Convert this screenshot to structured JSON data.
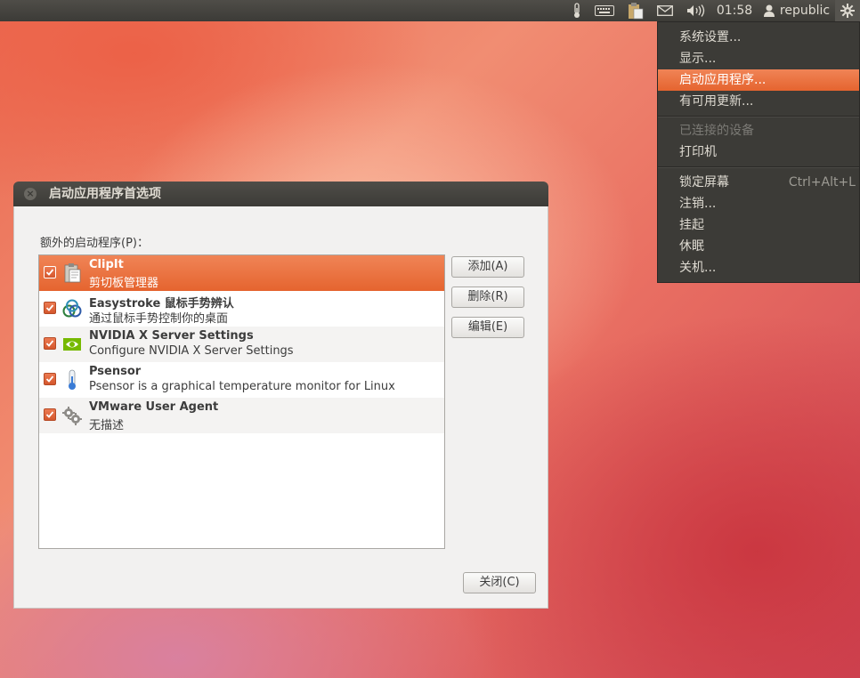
{
  "panel": {
    "clock": "01:58",
    "user": "republic",
    "icons": [
      "thermometer-icon",
      "keyboard-icon",
      "clipboard-icon",
      "mail-icon",
      "volume-icon",
      "user-icon",
      "gear-icon"
    ]
  },
  "system_menu": {
    "items": [
      {
        "label": "系统设置..."
      },
      {
        "label": "显示..."
      },
      {
        "label": "启动应用程序...",
        "state": "highlighted"
      },
      {
        "label": "有可用更新..."
      },
      {
        "label": "已连接的设备",
        "state": "disabled"
      },
      {
        "label": "打印机"
      },
      {
        "label": "锁定屏幕",
        "accel": "Ctrl+Alt+L"
      },
      {
        "label": "注销..."
      },
      {
        "label": "挂起"
      },
      {
        "label": "休眠"
      },
      {
        "label": "关机..."
      }
    ]
  },
  "dialog": {
    "title": "启动应用程序首选项",
    "list_label": "额外的启动程序(P)：",
    "apps": [
      {
        "name": "ClipIt",
        "desc": "剪切板管理器",
        "checked": true,
        "selected": true,
        "icon": "clipboard-icon"
      },
      {
        "name": "Easystroke 鼠标手势辨认",
        "desc": "通过鼠标手势控制你的桌面",
        "checked": true,
        "icon": "easystroke-icon"
      },
      {
        "name": "NVIDIA X Server Settings",
        "desc": "Configure NVIDIA X Server Settings",
        "checked": true,
        "icon": "nvidia-icon"
      },
      {
        "name": "Psensor",
        "desc": "Psensor is a graphical temperature monitor for Linux",
        "checked": true,
        "icon": "thermometer-icon"
      },
      {
        "name": "VMware User Agent",
        "desc": "无描述",
        "checked": true,
        "icon": "gears-icon"
      }
    ],
    "buttons": {
      "add": "添加(A)",
      "remove": "删除(R)",
      "edit": "编辑(E)",
      "close": "关闭(C)"
    }
  },
  "colors": {
    "accent": "#e95420",
    "panel": "#3c3b37",
    "dialog_bg": "#f2f1f0"
  }
}
